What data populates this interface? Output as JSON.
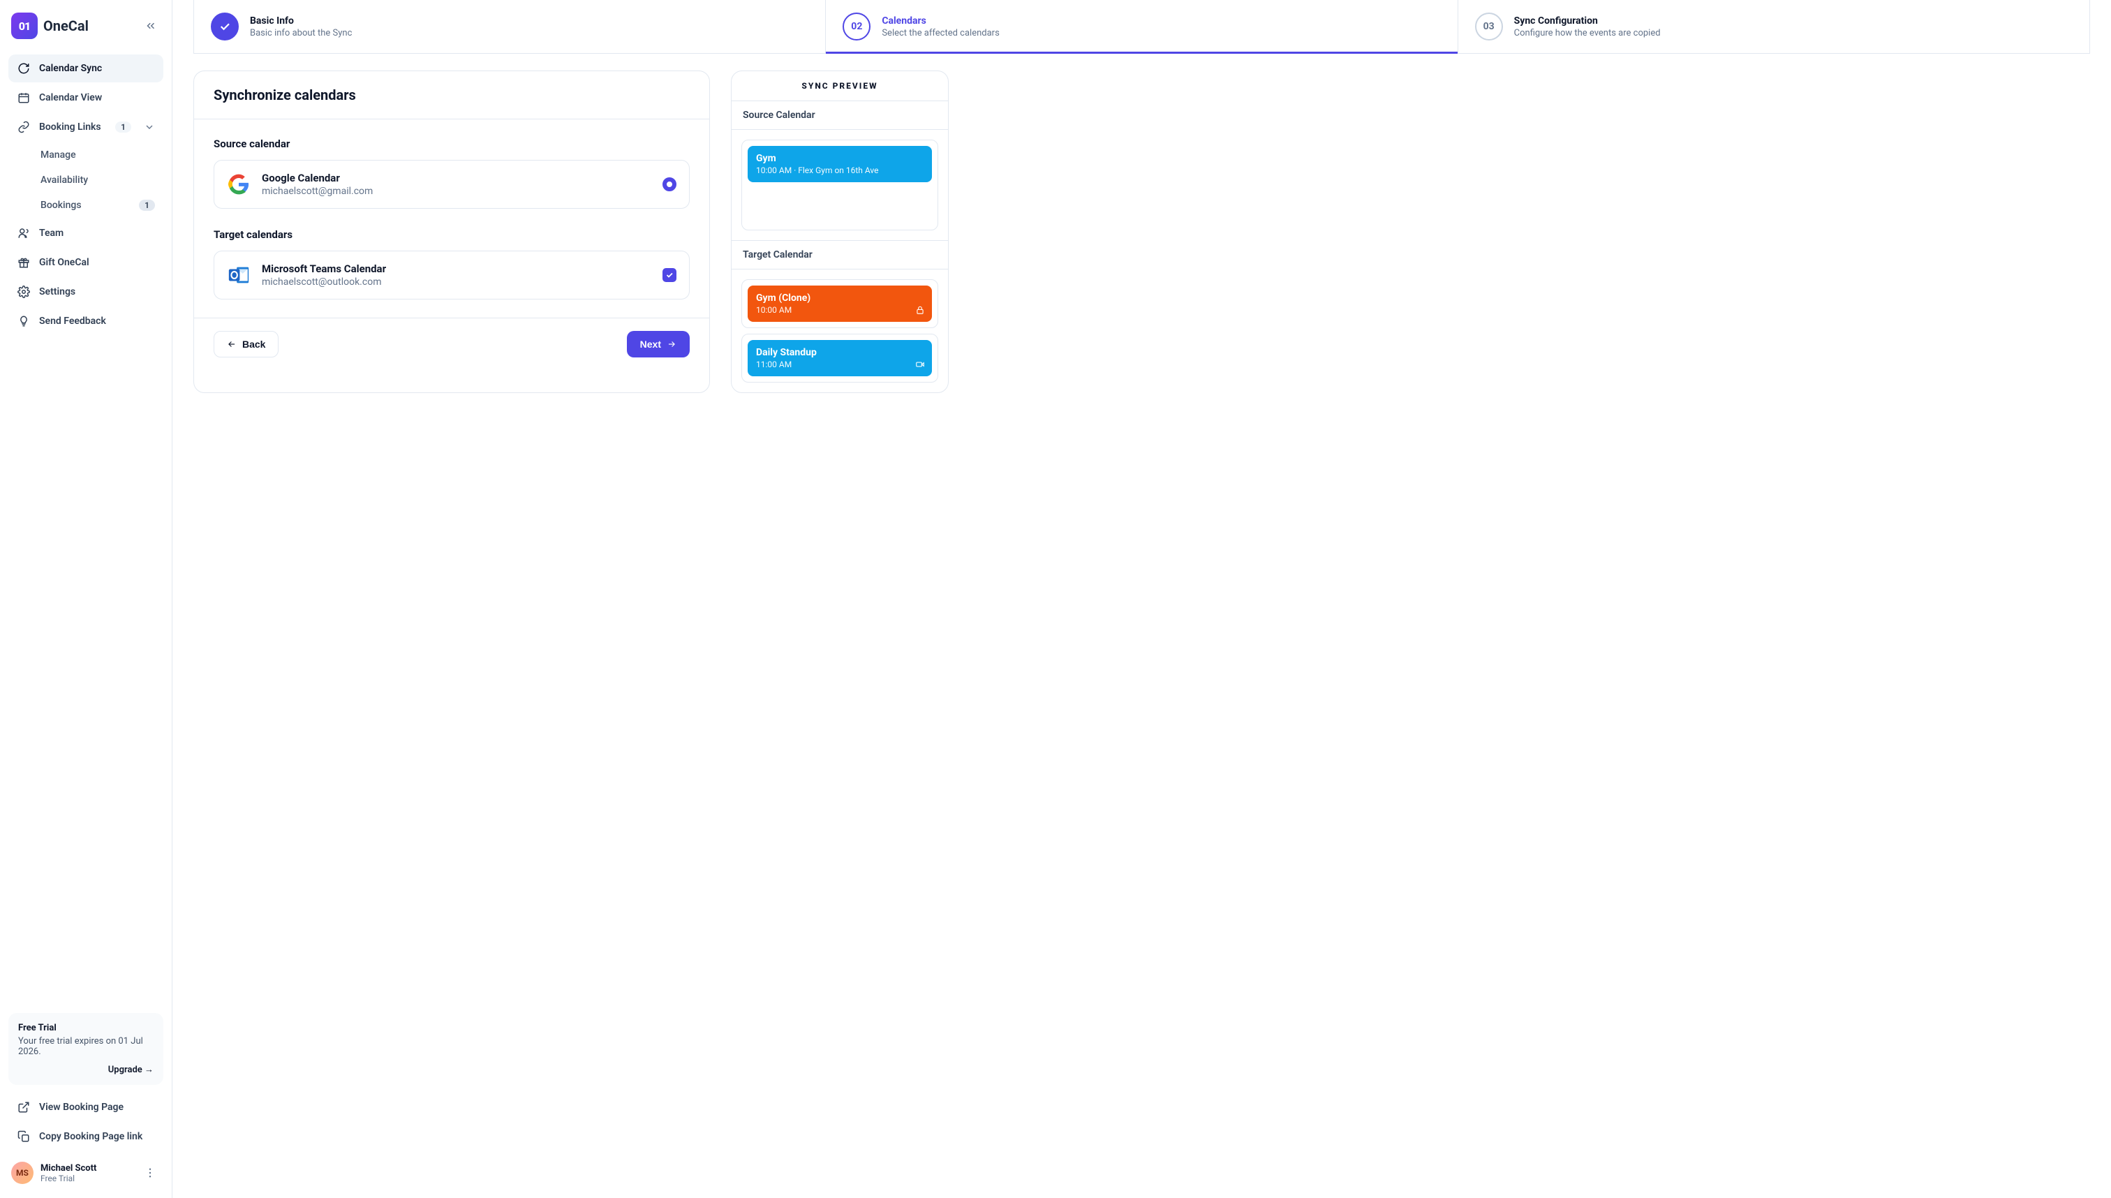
{
  "brand": {
    "name": "OneCal",
    "mark": "01"
  },
  "sidebar": {
    "items": [
      {
        "label": "Calendar Sync"
      },
      {
        "label": "Calendar View"
      },
      {
        "label": "Booking Links",
        "badge": "1"
      }
    ],
    "sub": [
      {
        "label": "Manage"
      },
      {
        "label": "Availability"
      },
      {
        "label": "Bookings",
        "badge": "1"
      }
    ],
    "items2": [
      {
        "label": "Team"
      },
      {
        "label": "Gift OneCal"
      },
      {
        "label": "Settings"
      },
      {
        "label": "Send Feedback"
      }
    ],
    "trial": {
      "title": "Free Trial",
      "desc": "Your free trial expires on 01 Jul 2026.",
      "upgrade": "Upgrade →"
    },
    "footer": [
      {
        "label": "View Booking Page"
      },
      {
        "label": "Copy Booking Page link"
      }
    ],
    "user": {
      "name": "Michael Scott",
      "plan": "Free Trial",
      "initials": "MS"
    }
  },
  "stepper": {
    "steps": [
      {
        "num": "✓",
        "title": "Basic Info",
        "desc": "Basic info about the Sync"
      },
      {
        "num": "02",
        "title": "Calendars",
        "desc": "Select the affected calendars"
      },
      {
        "num": "03",
        "title": "Sync Configuration",
        "desc": "Configure how the events are copied"
      }
    ]
  },
  "content": {
    "heading": "Synchronize calendars",
    "source_label": "Source calendar",
    "target_label": "Target calendars",
    "source": {
      "name": "Google Calendar",
      "email": "michaelscott@gmail.com"
    },
    "target": {
      "name": "Microsoft Teams Calendar",
      "email": "michaelscott@outlook.com"
    },
    "back": "Back",
    "next": "Next"
  },
  "preview": {
    "header": "SYNC PREVIEW",
    "source_title": "Source Calendar",
    "target_title": "Target Calendar",
    "source_events": [
      {
        "title": "Gym",
        "sub": "10:00 AM · Flex Gym on 16th Ave"
      }
    ],
    "target_events": [
      {
        "title": "Gym (Clone)",
        "sub": "10:00 AM"
      },
      {
        "title": "Daily Standup",
        "sub": "11:00 AM"
      }
    ]
  }
}
